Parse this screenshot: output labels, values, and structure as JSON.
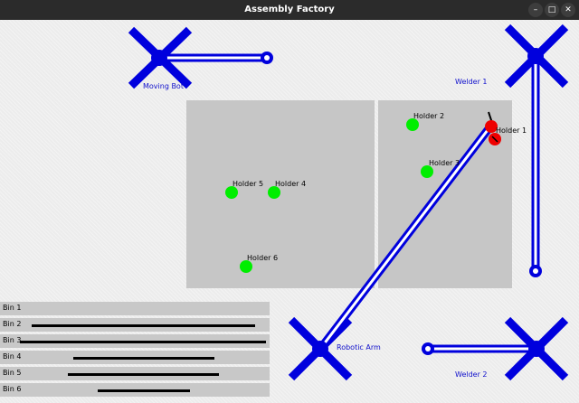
{
  "window": {
    "title": "Assembly Factory",
    "controls": {
      "minimize": "–",
      "maximize": "□",
      "close": "✕"
    }
  },
  "labels": {
    "moving_bot": "Moving Bot",
    "welder_1": "Welder 1",
    "welder_2": "Welder 2",
    "robotic_arm": "Robotic Arm"
  },
  "holders": [
    {
      "label": "Holder 1",
      "state": "red"
    },
    {
      "label": "Holder 2",
      "state": "green"
    },
    {
      "label": "Holder 3",
      "state": "green"
    },
    {
      "label": "Holder 4",
      "state": "green"
    },
    {
      "label": "Holder 5",
      "state": "green"
    },
    {
      "label": "Holder 6",
      "state": "green"
    }
  ],
  "bins": [
    {
      "label": "Bin 1"
    },
    {
      "label": "Bin 2"
    },
    {
      "label": "Bin 3"
    },
    {
      "label": "Bin 4"
    },
    {
      "label": "Bin 5"
    },
    {
      "label": "Bin 6"
    }
  ],
  "colors": {
    "robot_blue": "#0000dd",
    "holder_green": "#00ee00",
    "holder_red": "#ee0000",
    "table_gray": "#c6c6c6",
    "label_blue": "#1010cc"
  }
}
